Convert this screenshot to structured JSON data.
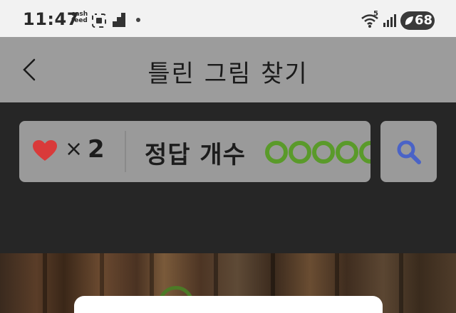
{
  "status_bar": {
    "time": "11:47",
    "app_badge_line1": "cash",
    "app_badge_line2": "feed",
    "battery": "68",
    "wifi_badge": "5"
  },
  "header": {
    "title": "틀린 그림 찾기",
    "back_icon": "chevron-left-icon"
  },
  "game_info": {
    "lives_symbol": "×",
    "lives_count": "2",
    "answer_label": "정답 개수",
    "answers_found": 0,
    "answer_circles": 5
  },
  "colors": {
    "header_bg": "#9c9c9c",
    "panel_bg": "#9a9a9a",
    "heart": "#d93a3a",
    "answer_circle": "#5a9a2a",
    "search_icon": "#4a63c7"
  },
  "search_button": {
    "icon": "magnifier-icon"
  }
}
